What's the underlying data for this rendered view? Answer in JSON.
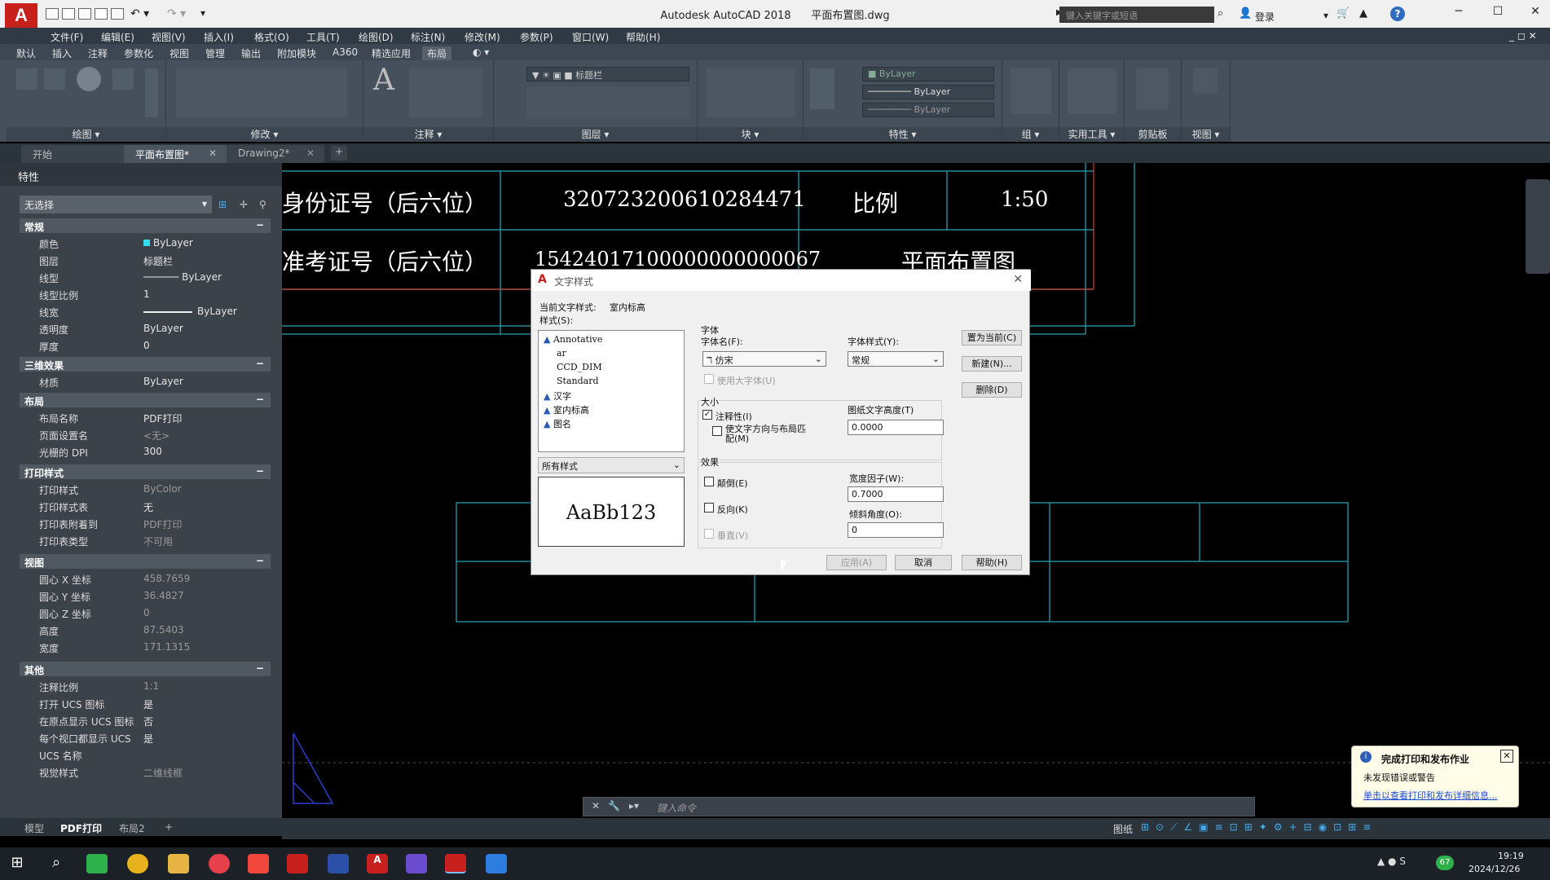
{
  "titlebar": {
    "logo": "A",
    "title": "Autodesk AutoCAD 2018",
    "filename": "平面布置图.dwg",
    "search_placeholder": "键入关键字或短语",
    "login": "登录",
    "minimize": "─",
    "maximize": "☐",
    "close": "✕"
  },
  "menu": [
    "文件(F)",
    "编辑(E)",
    "视图(V)",
    "插入(I)",
    "格式(O)",
    "工具(T)",
    "绘图(D)",
    "标注(N)",
    "修改(M)",
    "参数(P)",
    "窗口(W)",
    "帮助(H)"
  ],
  "ribbon_tabs": [
    "默认",
    "插入",
    "注释",
    "参数化",
    "视图",
    "管理",
    "输出",
    "附加模块",
    "A360",
    "精选应用",
    "布局"
  ],
  "ribbon_active_tab": "布局",
  "ribbon_panels": [
    "绘图",
    "修改",
    "注释",
    "图层",
    "块",
    "特性",
    "组",
    "实用工具",
    "剪贴板",
    "视图"
  ],
  "ribbon_props": {
    "bylayer1": "ByLayer",
    "bylayer2": "ByLayer"
  },
  "doc_tabs": [
    "开始",
    "平面布置图*",
    "Drawing2*"
  ],
  "doc_tab_active": "平面布置图*",
  "props": {
    "title": "特性",
    "selection": "无选择",
    "sections": {
      "general": "常规",
      "threed": "三维效果",
      "layout": "布局",
      "plotstyle": "打印样式",
      "view": "视图",
      "other": "其他"
    },
    "rows": {
      "color": {
        "k": "颜色",
        "v": "ByLayer"
      },
      "layer": {
        "k": "图层",
        "v": "标题栏"
      },
      "linetype": {
        "k": "线型",
        "v": "ByLayer"
      },
      "ltscale": {
        "k": "线型比例",
        "v": "1"
      },
      "lineweight": {
        "k": "线宽",
        "v": "ByLayer"
      },
      "transparency": {
        "k": "透明度",
        "v": "ByLayer"
      },
      "thickness": {
        "k": "厚度",
        "v": "0"
      },
      "material": {
        "k": "材质",
        "v": "ByLayer"
      },
      "layoutname": {
        "k": "布局名称",
        "v": "PDF打印"
      },
      "pagesetup": {
        "k": "页面设置名",
        "v": "<无>"
      },
      "rasterdpi": {
        "k": "光栅的 DPI",
        "v": "300"
      },
      "plotstyle": {
        "k": "打印样式",
        "v": "ByColor"
      },
      "plotstyletable": {
        "k": "打印样式表",
        "v": "无"
      },
      "attachedto": {
        "k": "打印表附着到",
        "v": "PDF打印"
      },
      "tabletype": {
        "k": "打印表类型",
        "v": "不可用"
      },
      "cx": {
        "k": "圆心 X 坐标",
        "v": "458.7659"
      },
      "cy": {
        "k": "圆心 Y 坐标",
        "v": "36.4827"
      },
      "cz": {
        "k": "圆心 Z 坐标",
        "v": "0"
      },
      "height": {
        "k": "高度",
        "v": "87.5403"
      },
      "width": {
        "k": "宽度",
        "v": "171.1315"
      },
      "annoscale": {
        "k": "注释比例",
        "v": "1:1"
      },
      "ucsicon": {
        "k": "打开 UCS 图标",
        "v": "是"
      },
      "ucsorigin": {
        "k": "在原点显示 UCS 图标",
        "v": "否"
      },
      "ucsvp": {
        "k": "每个视口都显示 UCS",
        "v": "是"
      },
      "ucsname": {
        "k": "UCS 名称",
        "v": ""
      },
      "visualstyle": {
        "k": "视觉样式",
        "v": "二维线框"
      }
    }
  },
  "layout_tabs": [
    "模型",
    "PDF打印",
    "布局2"
  ],
  "drawing": {
    "id_label": "身份证号（后六位）",
    "id_value": "320723200610284471",
    "scale_label": "比例",
    "scale_value": "1:50",
    "exam_label": "准考证号（后六位）",
    "exam_value": "15424017100000000000067",
    "drawing_name": "平面布置图"
  },
  "command": {
    "placeholder": "键入命令"
  },
  "dialog": {
    "title": "文字样式",
    "current_label": "当前文字样式:",
    "current_value": "室内标高",
    "styles_label": "样式(S):",
    "styles": [
      "Annotative",
      "ar",
      "CCD_DIM",
      "Standard",
      "汉字",
      "室内标高",
      "图名"
    ],
    "filter": "所有样式",
    "preview": "AaBb123",
    "font_group": "字体",
    "font_name_label": "字体名(F):",
    "font_name": "仿宋",
    "font_style_label": "字体样式(Y):",
    "font_style": "常规",
    "bigfont": "使用大字体(U)",
    "size_group": "大小",
    "annotative": "注释性(I)",
    "match_orient": "使文字方向与布局匹配(M)",
    "paper_height_label": "图纸文字高度(T)",
    "paper_height": "0.0000",
    "effects_group": "效果",
    "upside": "颠倒(E)",
    "backwards": "反向(K)",
    "vertical": "垂直(V)",
    "width_label": "宽度因子(W):",
    "width_value": "0.7000",
    "oblique_label": "倾斜角度(O):",
    "oblique_value": "0",
    "btn_current": "置为当前(C)",
    "btn_new": "新建(N)...",
    "btn_delete": "删除(D)",
    "btn_apply": "应用(A)",
    "btn_cancel": "取消",
    "btn_help": "帮助(H)"
  },
  "status": {
    "grid": "图纸"
  },
  "notification": {
    "title": "完成打印和发布作业",
    "body": "未发现错误或警告",
    "link": "单击以查看打印和发布详细信息..."
  },
  "taskbar": {
    "time": "19:19",
    "date": "2024/12/26",
    "badge": "67"
  }
}
